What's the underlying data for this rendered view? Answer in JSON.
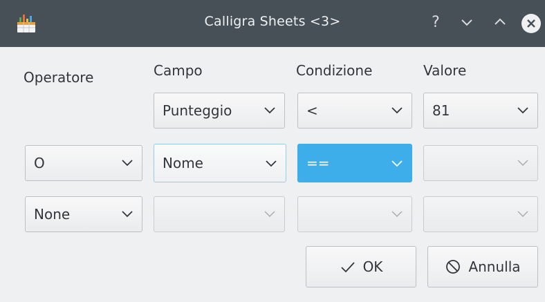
{
  "window": {
    "title": "Calligra Sheets <3>"
  },
  "titlebar_buttons": {
    "help": "?"
  },
  "headers": {
    "operator": "Operatore",
    "field": "Campo",
    "condition": "Condizione",
    "value": "Valore"
  },
  "rows": [
    {
      "operator": "",
      "field": "Punteggio",
      "condition": "<",
      "value": "81"
    },
    {
      "operator": "O",
      "field": "Nome",
      "condition": "==",
      "value": ""
    },
    {
      "operator": "None",
      "field": "",
      "condition": "",
      "value": ""
    }
  ],
  "buttons": {
    "ok": "OK",
    "cancel": "Annulla"
  },
  "colors": {
    "titlebar": "#475057",
    "accent": "#3daee9",
    "background": "#eff0f1",
    "text": "#31363b"
  },
  "icons": [
    "calligra-sheets-app-icon",
    "help-icon",
    "minimize-icon",
    "maximize-icon",
    "close-icon",
    "chevron-down-icon",
    "check-icon",
    "cancel-icon"
  ]
}
